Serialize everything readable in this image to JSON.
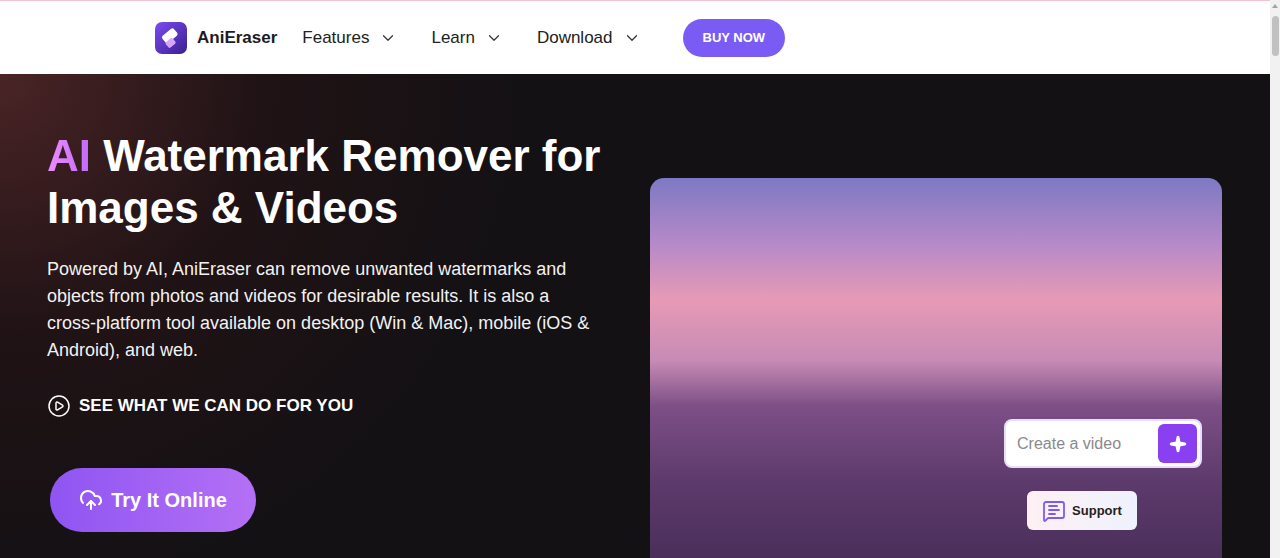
{
  "brand": {
    "name": "AniEraser"
  },
  "nav": {
    "items": [
      {
        "label": "Features",
        "expanded": false
      },
      {
        "label": "Learn",
        "expanded": false
      },
      {
        "label": "Download",
        "expanded": false
      }
    ],
    "cta": "BUY NOW"
  },
  "hero": {
    "title": {
      "highlight": "AI",
      "lines": [
        "Watermark Remover for",
        "Images & Videos"
      ]
    },
    "description": "Powered by AI, AniEraser can remove unwanted watermarks and objects from photos and videos for desirable results. It is also a cross-platform tool available on desktop (Win & Mac), mobile (iOS & Android), and web.",
    "link": "SEE WHAT WE CAN DO FOR YOU",
    "button": "Try It Online"
  },
  "preview": {
    "prompt": {
      "placeholder": "Create a video"
    },
    "support": "Support"
  }
}
